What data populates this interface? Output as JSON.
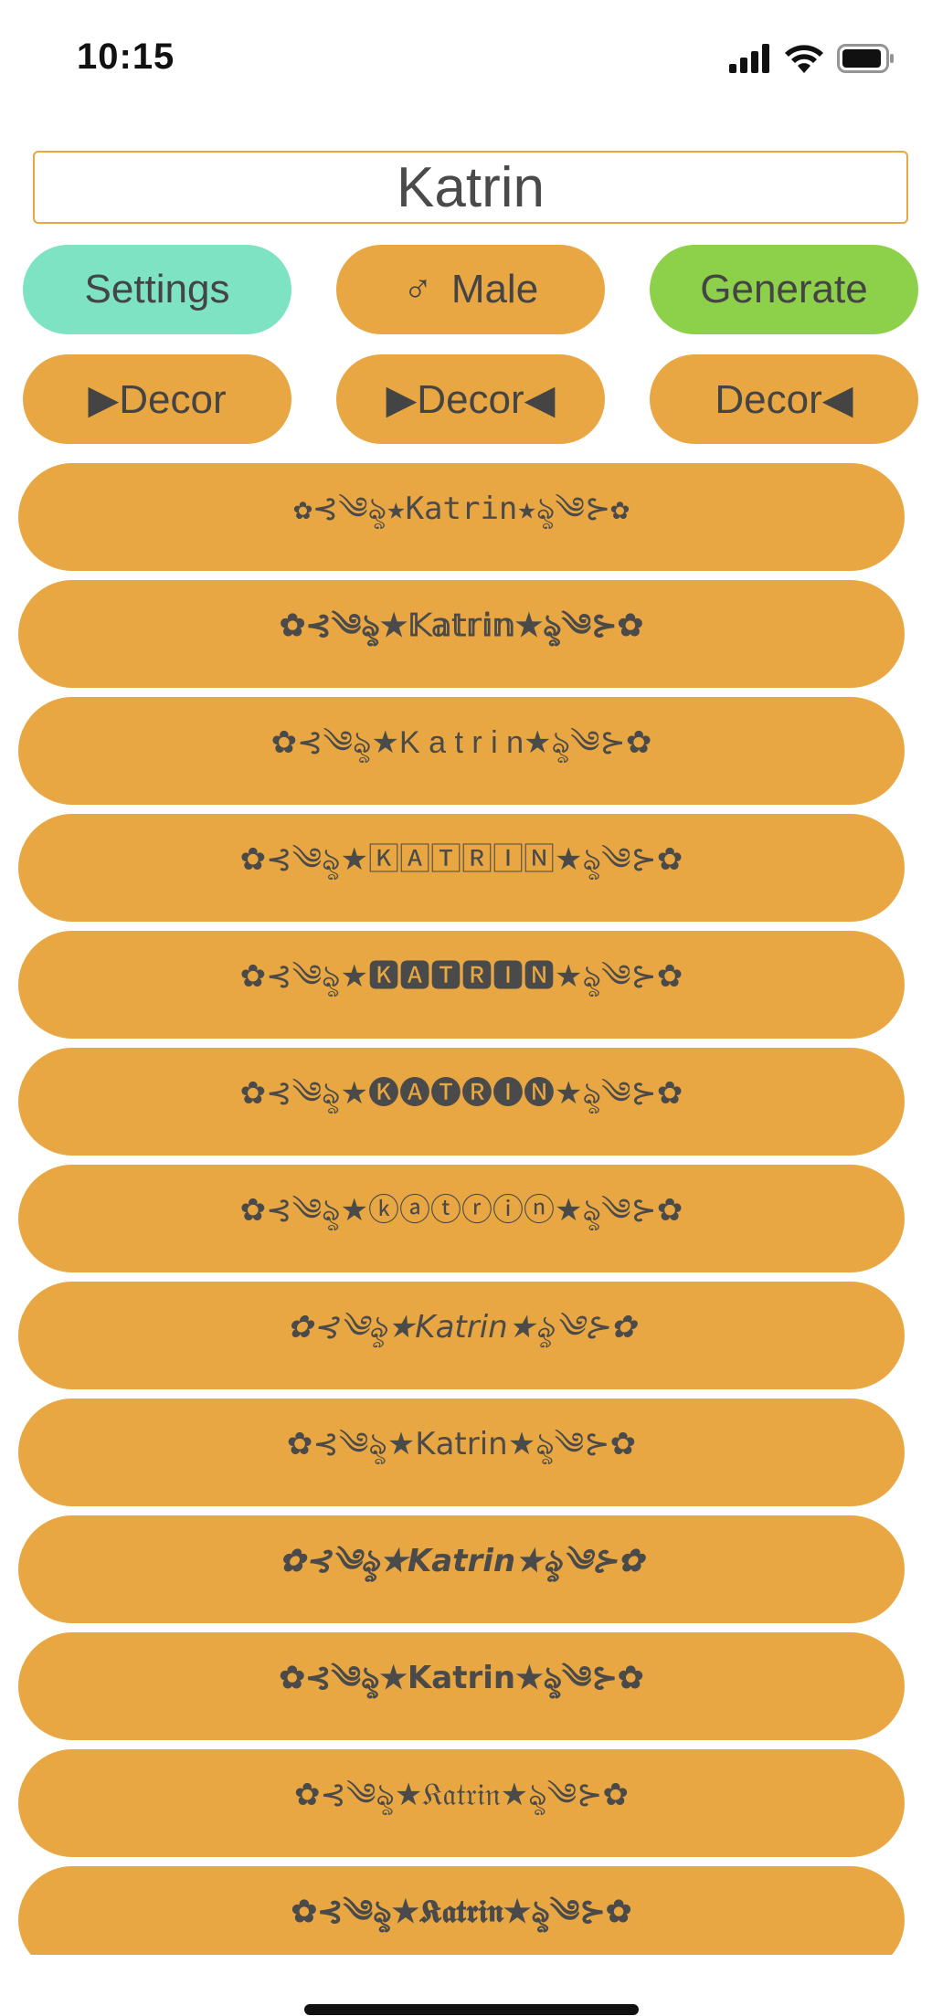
{
  "status_bar": {
    "time": "10:15",
    "icons": [
      "cellular-signal-icon",
      "wifi-icon",
      "battery-icon"
    ]
  },
  "name_input": {
    "value": "Katrin"
  },
  "buttons": {
    "settings": "Settings",
    "gender_icon": "♂",
    "gender": "Male",
    "generate": "Generate",
    "decor_left": "▶Decor",
    "decor_both": "▶Decor◀",
    "decor_right": "Decor◀"
  },
  "colors": {
    "accent_orange": "#e8a742",
    "settings_teal": "#7ee3c3",
    "generate_green": "#8dd14a",
    "text_gray": "#4a4a4a"
  },
  "results": [
    "✿⊰༄ৡ★𝙺𝚊𝚝𝚛𝚒𝚗★ৡ༄⊱✿",
    "✿⊰༄ৡ★𝕂𝕒𝕥𝕣𝕚𝕟★ৡ༄⊱✿",
    "✿⊰༄ৡ★K a t r i n★ৡ༄⊱✿",
    "✿⊰༄ৡ★🄺🄰🅃🅁🄸🄽★ৡ༄⊱✿",
    "✿⊰༄ৡ★🅺🅰🆃🆁🅸🅽★ৡ༄⊱✿",
    "✿⊰༄ৡ★🅚🅐🅣🅡🅘🅝★ৡ༄⊱✿",
    "✿⊰༄ৡ★ⓚⓐⓣⓡⓘⓝ★ৡ༄⊱✿",
    "✿⊰༄ৡ★𝘒𝘢𝘵𝘳𝘪𝘯★ৡ༄⊱✿",
    "✿⊰༄ৡ★𝖪𝖺𝗍𝗋𝗂𝗇★ৡ༄⊱✿",
    "✿⊰༄ৡ★𝙆𝙖𝙩𝙧𝙞𝙣★ৡ༄⊱✿",
    "✿⊰༄ৡ★𝗞𝗮𝘁𝗿𝗶𝗻★ৡ༄⊱✿",
    "✿⊰༄ৡ★𝔎𝔞𝔱𝔯𝔦𝔫★ৡ༄⊱✿",
    "✿⊰༄ৡ★𝕶𝖆𝖙𝖗𝖎𝖓★ৡ༄⊱✿"
  ]
}
